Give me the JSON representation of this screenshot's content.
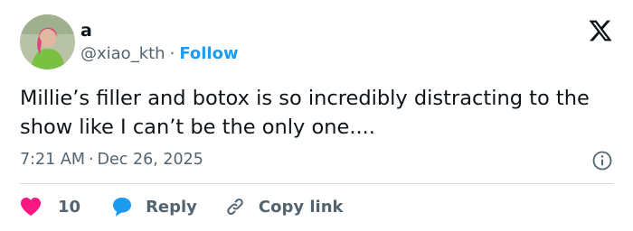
{
  "author": {
    "display_name": "a",
    "handle": "@xiao_kth",
    "separator": "·",
    "follow_label": "Follow"
  },
  "tweet": {
    "text": "Millie’s filler and botox is so incredibly distracting to the show like I can’t be the only one....",
    "time": "7:21 AM",
    "separator": "·",
    "date": "Dec 26, 2025"
  },
  "actions": {
    "like_count": "10",
    "reply_label": "Reply",
    "copy_link_label": "Copy link"
  },
  "icons": {
    "brand": "x-logo-icon",
    "info": "info-icon",
    "like": "heart-icon",
    "reply": "speech-bubble-icon",
    "copy": "link-icon"
  },
  "colors": {
    "accent": "#1d9bf0",
    "text": "#0f1419",
    "muted": "#536471",
    "like": "#f91880",
    "divider": "#cfd9de",
    "avatar_bg": "#b8c2a6",
    "avatar_outfit": "#79c043",
    "avatar_hair": "#e0457b"
  }
}
